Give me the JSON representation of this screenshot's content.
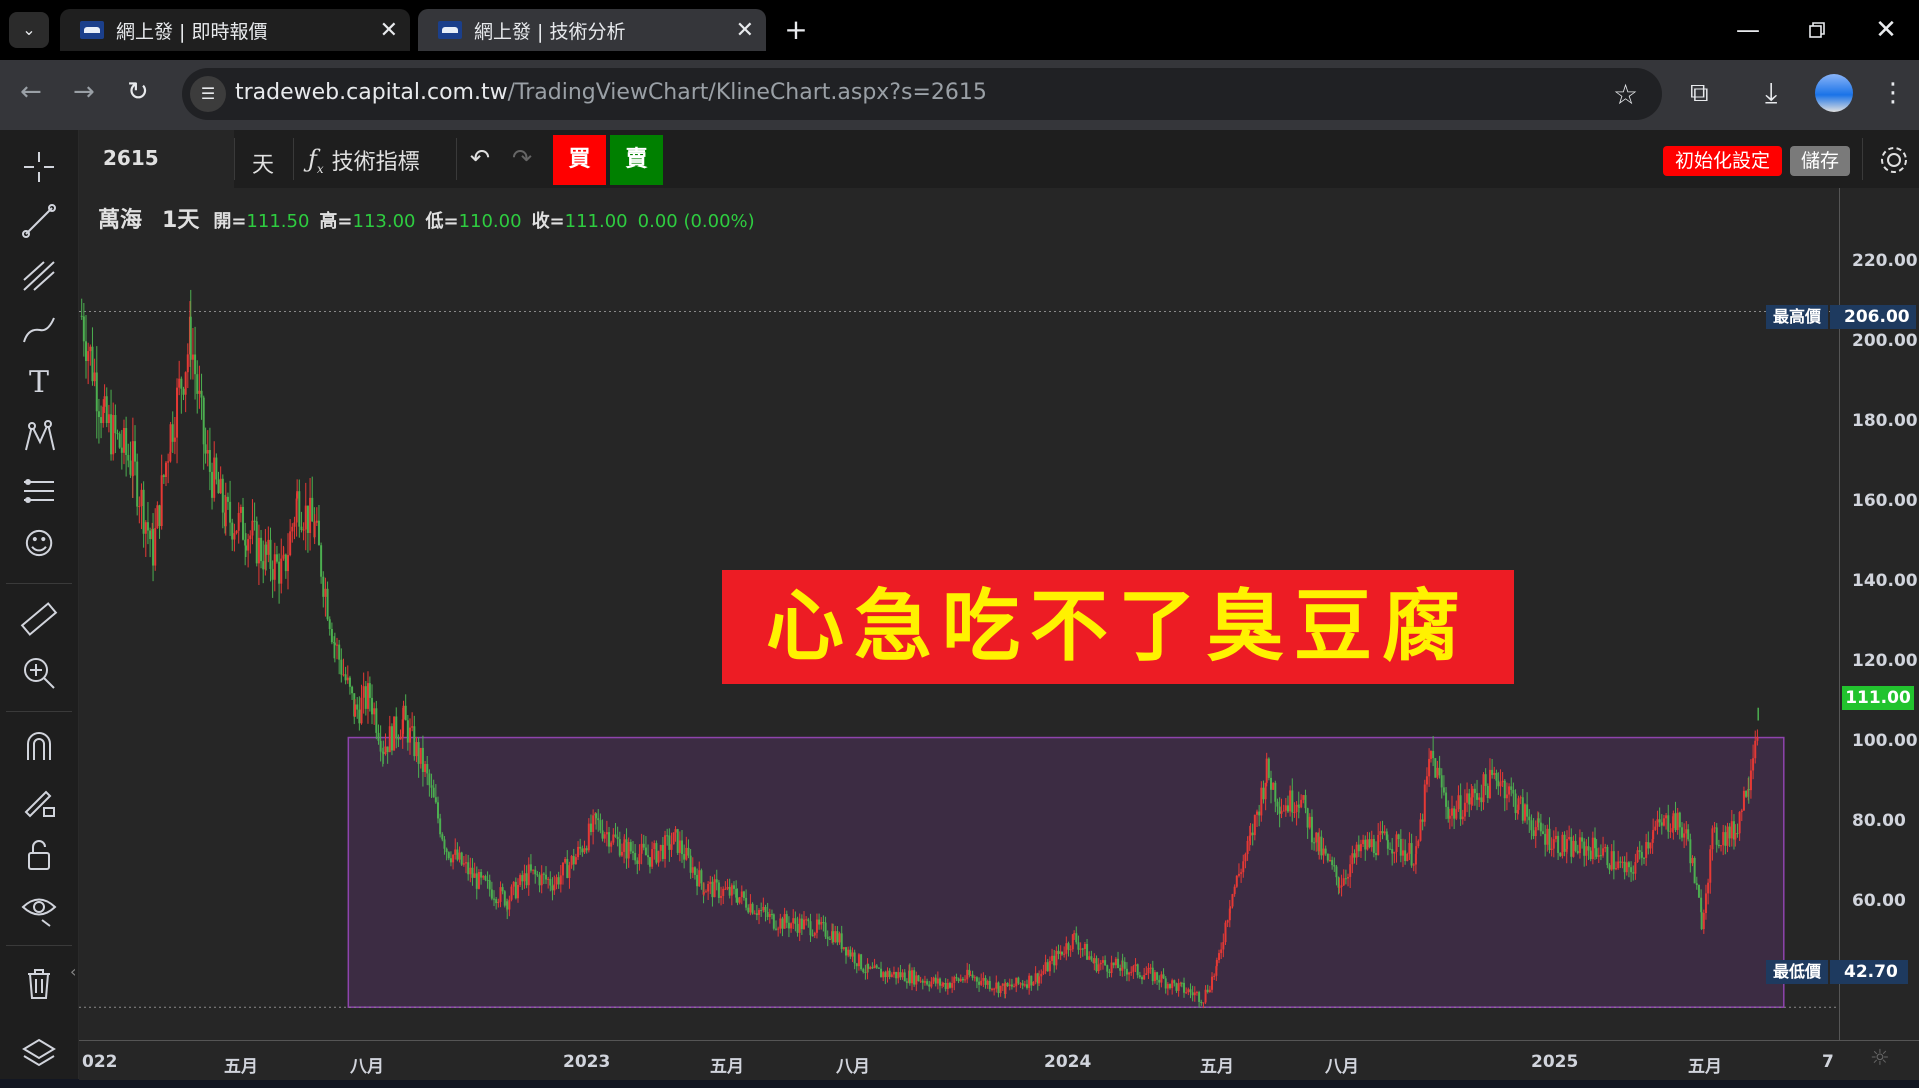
{
  "browser": {
    "tabs": [
      {
        "label": "網上發 | 即時報價"
      },
      {
        "label": "網上發 | 技術分析"
      }
    ],
    "url_domain": "tradeweb.capital.com.tw",
    "url_path": "/TradingViewChart/KlineChart.aspx?s=2615"
  },
  "chart_toolbar": {
    "symbol": "2615",
    "interval": "天",
    "indicators_label": "技術指標",
    "buy_label": "買",
    "sell_label": "賣",
    "reset_label": "初始化設定",
    "save_label": "儲存"
  },
  "legend": {
    "name": "萬海",
    "interval": "1天",
    "open_label": "開=",
    "open": "111.50",
    "high_label": "高=",
    "high": "113.00",
    "low_label": "低=",
    "low": "110.00",
    "close_label": "收=",
    "close": "111.00",
    "change": "0.00 (0.00%)"
  },
  "annotation": {
    "text": "心急吃不了臭豆腐",
    "bg_color": "#ed1c24",
    "text_color": "#fff200"
  },
  "markers": {
    "high_label": "最高價",
    "high_value": "206.00",
    "low_label": "最低價",
    "low_value": "42.70",
    "last_value": "111.00"
  },
  "colors": {
    "up": "#e53935",
    "down": "#4caf50",
    "box": "#8e44ad"
  },
  "chart_data": {
    "type": "candlestick",
    "y_ticks": [
      "220.00",
      "200.00",
      "180.00",
      "160.00",
      "140.00",
      "120.00",
      "100.00",
      "80.00",
      "60.00"
    ],
    "x_ticks": [
      "022",
      "五月",
      "八月",
      "2023",
      "五月",
      "八月",
      "2024",
      "五月",
      "八月",
      "2025",
      "五月",
      "7"
    ],
    "ylim": [
      35,
      235
    ],
    "xlim": [
      "2022-01-01",
      "2025-07-31"
    ],
    "box": {
      "x": [
        "2022-07-20",
        "2025-06-20"
      ],
      "y": [
        42.7,
        106
      ]
    },
    "series": [
      {
        "x": "2022-01-03",
        "y": 205
      },
      {
        "x": "2022-01-20",
        "y": 180
      },
      {
        "x": "2022-02-10",
        "y": 170
      },
      {
        "x": "2022-02-25",
        "y": 150
      },
      {
        "x": "2022-03-10",
        "y": 178
      },
      {
        "x": "2022-03-25",
        "y": 200
      },
      {
        "x": "2022-04-05",
        "y": 172
      },
      {
        "x": "2022-04-20",
        "y": 158
      },
      {
        "x": "2022-05-05",
        "y": 155
      },
      {
        "x": "2022-05-20",
        "y": 148
      },
      {
        "x": "2022-06-02",
        "y": 145
      },
      {
        "x": "2022-06-12",
        "y": 162
      },
      {
        "x": "2022-06-25",
        "y": 155
      },
      {
        "x": "2022-07-10",
        "y": 128
      },
      {
        "x": "2022-07-25",
        "y": 112
      },
      {
        "x": "2022-08-05",
        "y": 116
      },
      {
        "x": "2022-08-15",
        "y": 104
      },
      {
        "x": "2022-08-30",
        "y": 110
      },
      {
        "x": "2022-09-15",
        "y": 98
      },
      {
        "x": "2022-10-01",
        "y": 80
      },
      {
        "x": "2022-10-25",
        "y": 72
      },
      {
        "x": "2022-11-15",
        "y": 68
      },
      {
        "x": "2022-12-01",
        "y": 74
      },
      {
        "x": "2022-12-20",
        "y": 72
      },
      {
        "x": "2023-01-05",
        "y": 78
      },
      {
        "x": "2023-01-20",
        "y": 86
      },
      {
        "x": "2023-02-10",
        "y": 80
      },
      {
        "x": "2023-03-01",
        "y": 78
      },
      {
        "x": "2023-03-20",
        "y": 82
      },
      {
        "x": "2023-04-10",
        "y": 71
      },
      {
        "x": "2023-05-05",
        "y": 69
      },
      {
        "x": "2023-06-01",
        "y": 63
      },
      {
        "x": "2023-06-25",
        "y": 62
      },
      {
        "x": "2023-07-15",
        "y": 60
      },
      {
        "x": "2023-08-10",
        "y": 51
      },
      {
        "x": "2023-09-10",
        "y": 50
      },
      {
        "x": "2023-10-05",
        "y": 48
      },
      {
        "x": "2023-10-25",
        "y": 50
      },
      {
        "x": "2023-11-20",
        "y": 47
      },
      {
        "x": "2023-12-15",
        "y": 50
      },
      {
        "x": "2024-01-01",
        "y": 56
      },
      {
        "x": "2024-01-10",
        "y": 59
      },
      {
        "x": "2024-01-25",
        "y": 53
      },
      {
        "x": "2024-02-15",
        "y": 52
      },
      {
        "x": "2024-03-10",
        "y": 50
      },
      {
        "x": "2024-03-30",
        "y": 47
      },
      {
        "x": "2024-04-15",
        "y": 45
      },
      {
        "x": "2024-04-25",
        "y": 52
      },
      {
        "x": "2024-05-05",
        "y": 68
      },
      {
        "x": "2024-05-20",
        "y": 82
      },
      {
        "x": "2024-06-01",
        "y": 98
      },
      {
        "x": "2024-06-12",
        "y": 90
      },
      {
        "x": "2024-06-25",
        "y": 92
      },
      {
        "x": "2024-07-10",
        "y": 80
      },
      {
        "x": "2024-07-25",
        "y": 72
      },
      {
        "x": "2024-08-10",
        "y": 80
      },
      {
        "x": "2024-08-30",
        "y": 82
      },
      {
        "x": "2024-09-20",
        "y": 78
      },
      {
        "x": "2024-10-01",
        "y": 102
      },
      {
        "x": "2024-10-15",
        "y": 88
      },
      {
        "x": "2024-11-01",
        "y": 92
      },
      {
        "x": "2024-11-20",
        "y": 97
      },
      {
        "x": "2024-12-05",
        "y": 90
      },
      {
        "x": "2024-12-20",
        "y": 84
      },
      {
        "x": "2025-01-10",
        "y": 80
      },
      {
        "x": "2025-02-01",
        "y": 80
      },
      {
        "x": "2025-02-25",
        "y": 74
      },
      {
        "x": "2025-03-15",
        "y": 84
      },
      {
        "x": "2025-03-30",
        "y": 87
      },
      {
        "x": "2025-04-10",
        "y": 82
      },
      {
        "x": "2025-04-20",
        "y": 63
      },
      {
        "x": "2025-04-28",
        "y": 82
      },
      {
        "x": "2025-05-15",
        "y": 84
      },
      {
        "x": "2025-05-25",
        "y": 97
      },
      {
        "x": "2025-06-01",
        "y": 111
      }
    ]
  }
}
